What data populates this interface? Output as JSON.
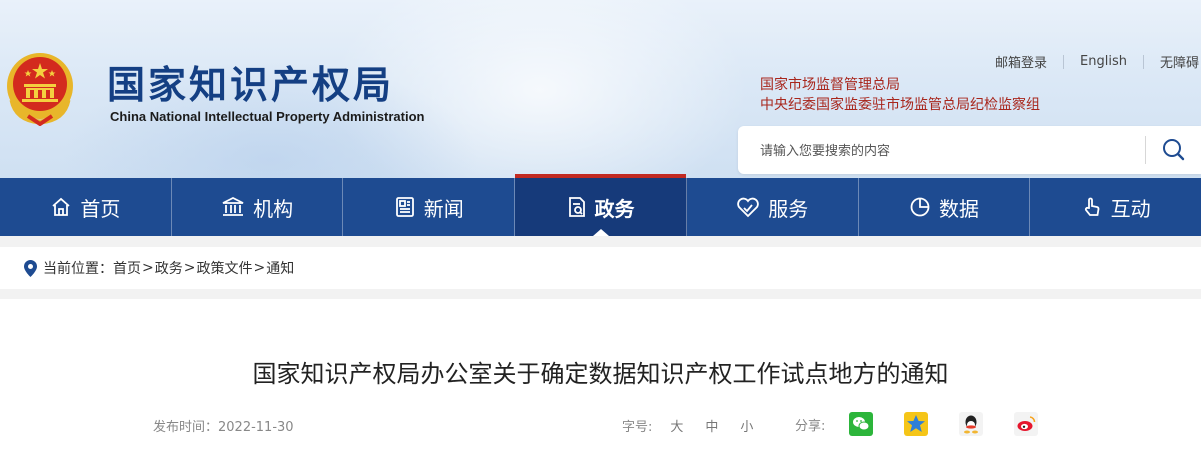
{
  "header": {
    "title": "国家知识产权局",
    "subtitle": "China National Intellectual Property Administration",
    "top_links": [
      "邮箱登录",
      "English",
      "无障碍"
    ],
    "related": [
      "国家市场监督管理总局",
      "中央纪委国家监委驻市场监管总局纪检监察组"
    ],
    "search_placeholder": "请输入您要搜索的内容"
  },
  "nav": {
    "items": [
      {
        "label": "首页",
        "icon": "home-icon"
      },
      {
        "label": "机构",
        "icon": "institution-icon"
      },
      {
        "label": "新闻",
        "icon": "news-icon"
      },
      {
        "label": "政务",
        "icon": "affairs-icon",
        "active": true
      },
      {
        "label": "服务",
        "icon": "service-icon"
      },
      {
        "label": "数据",
        "icon": "data-icon"
      },
      {
        "label": "互动",
        "icon": "interact-icon"
      }
    ]
  },
  "breadcrumb": {
    "prefix": "当前位置：",
    "items": [
      "首页",
      "政务",
      "政策文件",
      "通知"
    ],
    "separator": ">"
  },
  "article": {
    "title": "国家知识产权局办公室关于确定数据知识产权工作试点地方的通知",
    "date_label": "发布时间：",
    "date": "2022-11-30",
    "font_label": "字号:",
    "font_options": [
      "大",
      "中",
      "小"
    ],
    "share_label": "分享:",
    "share_icons": [
      "wechat-icon",
      "qzone-icon",
      "qq-icon",
      "weibo-icon"
    ]
  },
  "colors": {
    "nav_bg": "#1e4b91",
    "nav_active": "#163a7a",
    "accent_red": "#c22a22",
    "related_text": "#a8261c",
    "title_blue": "#143f83"
  }
}
